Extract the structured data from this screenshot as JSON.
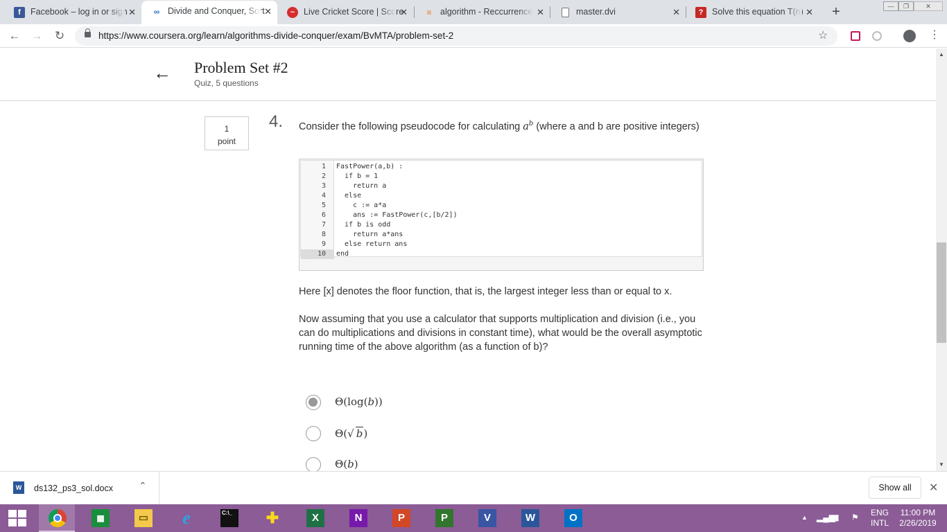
{
  "browser": {
    "tabs": [
      {
        "title": "Facebook – log in or sign",
        "icon": "facebook-icon",
        "color": "#3b5998",
        "glyph": "f",
        "active": false
      },
      {
        "title": "Divide and Conquer, Sort",
        "icon": "coursera-icon",
        "color": "#2a73cc",
        "glyph": "co",
        "active": true
      },
      {
        "title": "Live Cricket Score | Score",
        "icon": "cricket-icon",
        "color": "#d32f2f",
        "glyph": "",
        "active": false
      },
      {
        "title": "algorithm - Reccurrence",
        "icon": "stackoverflow-icon",
        "color": "#f48024",
        "glyph": "",
        "active": false
      },
      {
        "title": "master.dvi",
        "icon": "file-icon",
        "color": "#9aa0a6",
        "glyph": "",
        "active": false
      },
      {
        "title": "Solve this equation T(n)",
        "icon": "question-icon",
        "color": "#c62828",
        "glyph": "?",
        "active": false
      }
    ],
    "url": "https://www.coursera.org/learn/algorithms-divide-conquer/exam/BvMTA/problem-set-2"
  },
  "quiz": {
    "title": "Problem Set #2",
    "subtitle": "Quiz, 5 questions"
  },
  "question": {
    "points_value": "1",
    "points_label": "point",
    "number": "4.",
    "text_before": "Consider the following pseudocode for calculating ",
    "text_base": "a",
    "text_exp": "b",
    "text_after": " (where a and b are positive integers)",
    "code": [
      "FastPower(a,b) :",
      "  if b = 1",
      "    return a",
      "  else",
      "    c := a*a",
      "    ans := FastPower(c,[b/2])",
      "  if b is odd",
      "    return a*ans",
      "  else return ans",
      "end"
    ],
    "active_line": 10,
    "para1": "Here [x] denotes the floor function, that is, the largest integer less than or equal to x.",
    "para2": "Now assuming that you use a calculator that supports multiplication and division (i.e., you can do multiplications and divisions in constant time), what would be the overall asymptotic running time of the above algorithm (as a function of b)?",
    "options": [
      {
        "prefix": "Θ(log(",
        "var": "b",
        "suffix": "))",
        "selected": true
      },
      {
        "prefix": "Θ(√",
        "var": "b",
        "suffix": ")",
        "selected": false
      },
      {
        "prefix": "Θ(",
        "var": "b",
        "suffix": ")",
        "selected": false
      }
    ]
  },
  "downloads": {
    "file": "ds132_ps3_sol.docx",
    "show_all": "Show all"
  },
  "taskbar": {
    "apps": [
      "chrome-icon",
      "store-icon",
      "file-explorer-icon",
      "internet-explorer-icon",
      "cmd-icon",
      "game-icon",
      "excel-icon",
      "onenote-icon",
      "powerpoint-icon",
      "project-icon",
      "visio-icon",
      "word-icon",
      "outlook-icon"
    ],
    "lang1": "ENG",
    "lang2": "INTL",
    "time": "11:00 PM",
    "date": "2/26/2019"
  }
}
